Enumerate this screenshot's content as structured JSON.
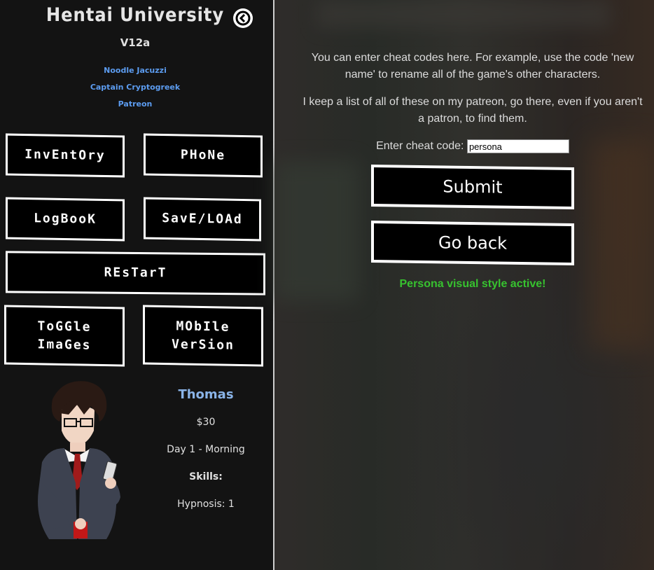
{
  "sidebar": {
    "game_title": "Hentai University",
    "version": "V12a",
    "credits": [
      "Noodle Jacuzzi",
      "Captain Cryptogreek",
      "Patreon"
    ],
    "buttons": {
      "inventory": "InvEntOry",
      "phone": "PHoNe",
      "logbook": "LogBooK",
      "save_load": "SavE/LOAd",
      "restart": "REsTarT",
      "toggle_images_1": "ToGGle",
      "toggle_images_2": "ImaGes",
      "mobile_version_1": "MObIle",
      "mobile_version_2": "VerSion"
    },
    "player": {
      "name": "Thomas",
      "money": "$30",
      "time": "Day 1 - Morning",
      "skills_label": "Skills:",
      "skill_hypnosis": "Hypnosis: 1"
    }
  },
  "main": {
    "info_1": "You can enter cheat codes here. For example, use the code 'new name' to rename all of the game's other characters.",
    "info_2": "I keep a list of all of these on my patreon, go there, even if you aren't a patron, to find them.",
    "cheat_label": "Enter cheat code:",
    "cheat_value": "persona",
    "submit_label": "Submit",
    "go_back_label": "Go back",
    "status": "Persona visual style active!"
  },
  "colors": {
    "sidebar_bg": "#131313",
    "link": "#5c9cf0",
    "status_green": "#37c22f",
    "player_name": "#8ab4e8"
  }
}
